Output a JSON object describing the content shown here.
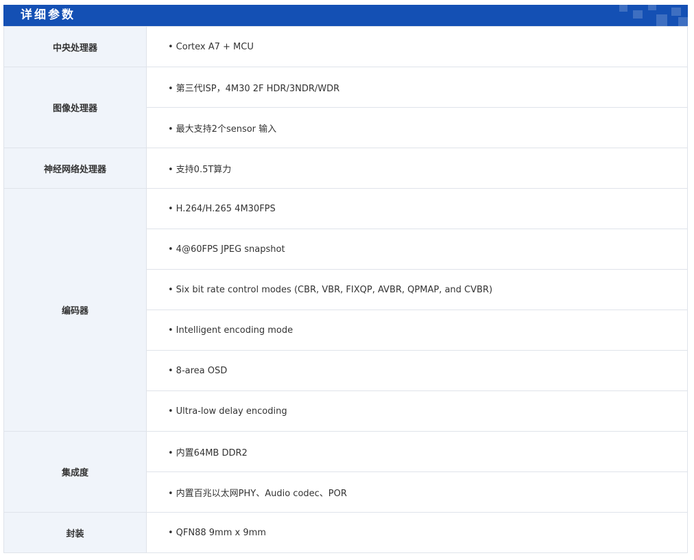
{
  "section_title": "详细参数",
  "specs": [
    {
      "category": "中央处理器",
      "values": [
        "Cortex A7 + MCU"
      ]
    },
    {
      "category": "图像处理器",
      "values": [
        "第三代ISP，4M30 2F HDR/3NDR/WDR",
        "最大支持2个sensor 输入"
      ]
    },
    {
      "category": "神经网络处理器",
      "values": [
        "支持0.5T算力"
      ]
    },
    {
      "category": "编码器",
      "values": [
        "H.264/H.265 4M30FPS",
        "4@60FPS JPEG snapshot",
        "Six bit rate control modes (CBR, VBR, FIXQP, AVBR, QPMAP, and CVBR)",
        "Intelligent encoding mode",
        "8-area OSD",
        "Ultra-low delay encoding"
      ]
    },
    {
      "category": "集成度",
      "values": [
        "内置64MB DDR2",
        "内置百兆以太网PHY、Audio codec、POR"
      ]
    },
    {
      "category": "封装",
      "values": [
        "QFN88 9mm x 9mm"
      ]
    }
  ],
  "colors": {
    "header_bg": "#1450b4",
    "category_bg": "#f0f4fa",
    "category_text": "#1a2a5a",
    "border": "#dfe3ea"
  }
}
